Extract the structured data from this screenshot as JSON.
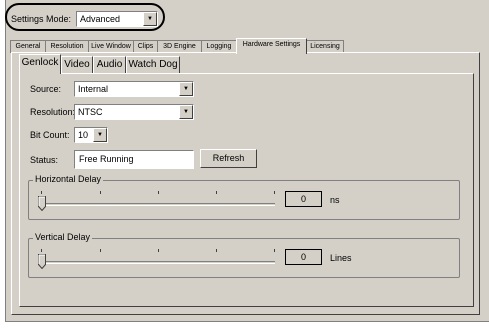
{
  "settings_mode": {
    "label": "Settings Mode:",
    "value": "Advanced"
  },
  "top_tabs": [
    {
      "label": "General"
    },
    {
      "label": "Resolution"
    },
    {
      "label": "Live Window"
    },
    {
      "label": "Clips"
    },
    {
      "label": "3D Engine"
    },
    {
      "label": "Logging"
    },
    {
      "label": "Hardware Settings"
    },
    {
      "label": "Licensing"
    }
  ],
  "active_top_tab": "Hardware Settings",
  "sub_tabs": [
    {
      "label": "Genlock"
    },
    {
      "label": "Video"
    },
    {
      "label": "Audio"
    },
    {
      "label": "Watch Dog"
    }
  ],
  "active_sub_tab": "Genlock",
  "genlock": {
    "source": {
      "label": "Source:",
      "value": "Internal"
    },
    "resolution": {
      "label": "Resolution:",
      "value": "NTSC"
    },
    "bit_count": {
      "label": "Bit Count:",
      "value": "10"
    },
    "status": {
      "label": "Status:",
      "value": "Free Running"
    },
    "refresh_label": "Refresh",
    "horizontal_delay": {
      "title": "Horizontal Delay",
      "value": "0",
      "unit": "ns",
      "slider_fraction": 0
    },
    "vertical_delay": {
      "title": "Vertical Delay",
      "value": "0",
      "unit": "Lines",
      "slider_fraction": 0
    }
  }
}
